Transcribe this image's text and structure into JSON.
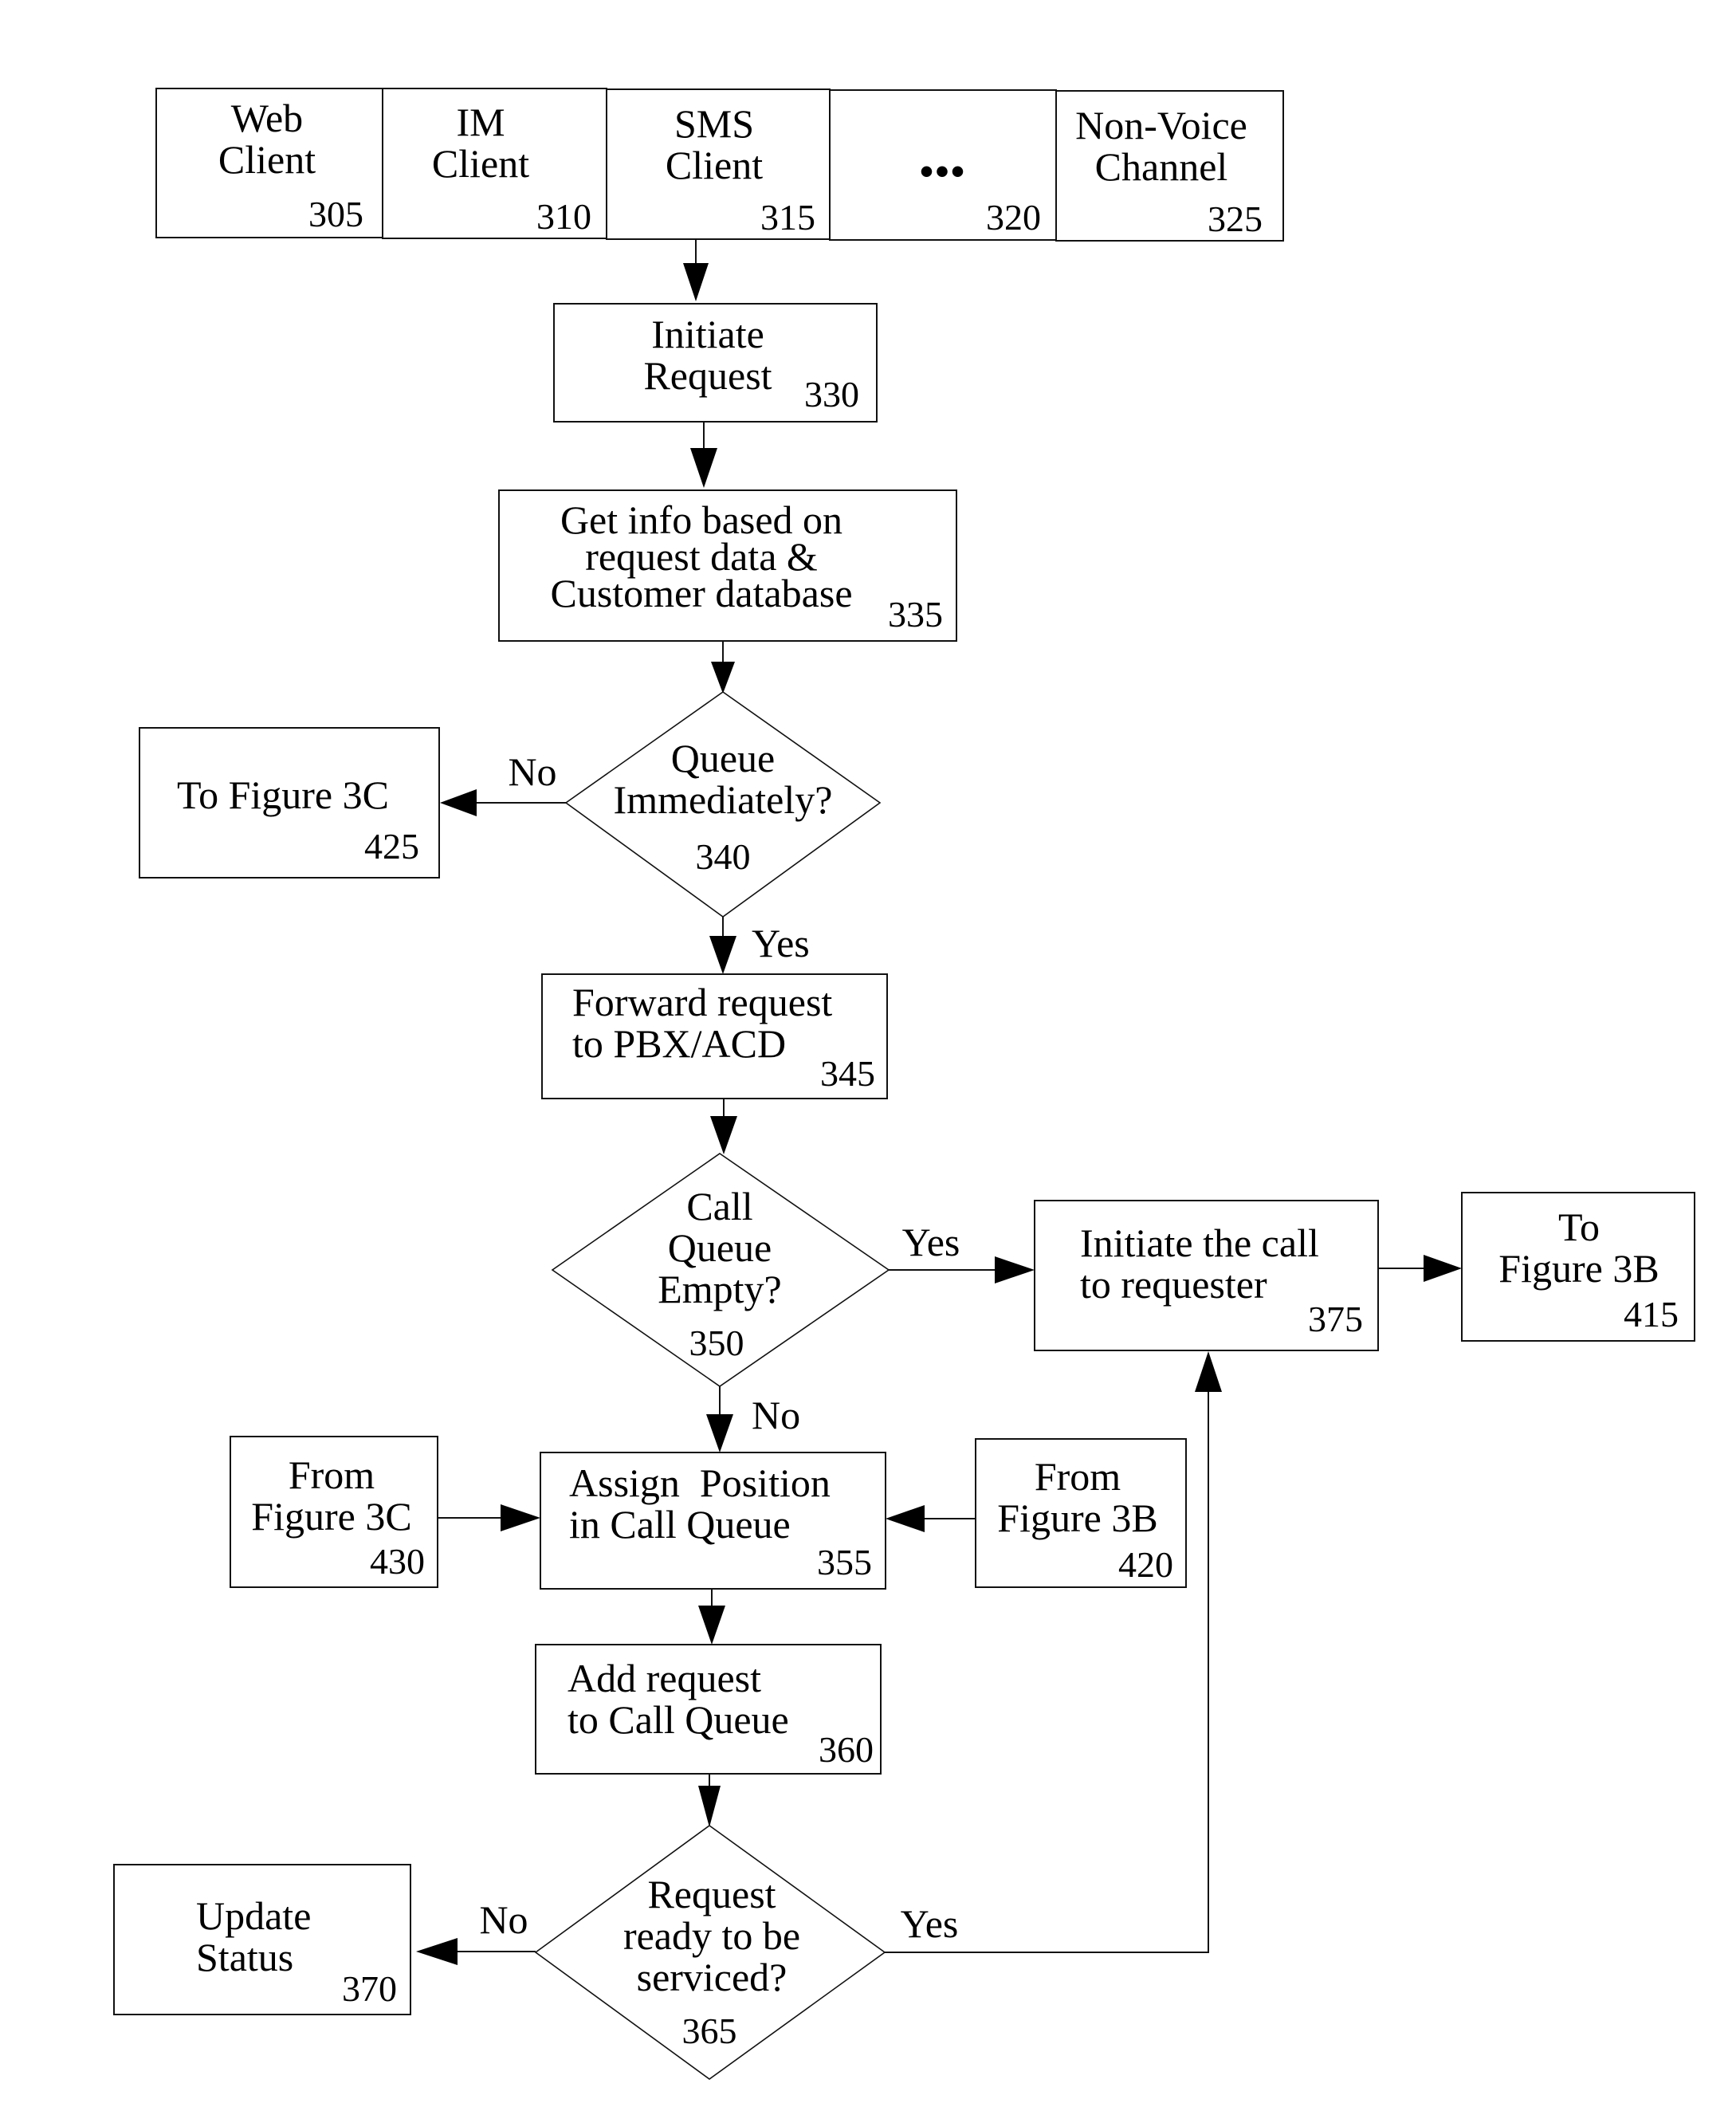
{
  "diagram": {
    "type": "flowchart",
    "channels": [
      {
        "id": "305",
        "lines": [
          "Web",
          "Client"
        ]
      },
      {
        "id": "310",
        "lines": [
          "IM",
          "Client"
        ]
      },
      {
        "id": "315",
        "lines": [
          "SMS",
          "Client"
        ]
      },
      {
        "id": "320",
        "lines": [
          "•••"
        ]
      },
      {
        "id": "325",
        "lines": [
          "Non-Voice",
          "Channel"
        ]
      }
    ],
    "nodes": {
      "n330": {
        "id": "330",
        "lines": [
          "Initiate",
          "Request"
        ]
      },
      "n335": {
        "id": "335",
        "lines": [
          "Get info based on",
          "request data &",
          "Customer database"
        ]
      },
      "n340": {
        "id": "340",
        "lines": [
          "Queue",
          "Immediately?"
        ],
        "shape": "decision"
      },
      "n425": {
        "id": "425",
        "lines": [
          "To Figure 3C"
        ]
      },
      "n345": {
        "id": "345",
        "lines": [
          "Forward request",
          "to PBX/ACD"
        ]
      },
      "n350": {
        "id": "350",
        "lines": [
          "Call",
          "Queue",
          "Empty?"
        ],
        "shape": "decision"
      },
      "n375": {
        "id": "375",
        "lines": [
          "Initiate the call",
          "to requester"
        ]
      },
      "n415": {
        "id": "415",
        "lines": [
          "To",
          "Figure 3B"
        ]
      },
      "n430": {
        "id": "430",
        "lines": [
          "From",
          "Figure 3C"
        ]
      },
      "n355": {
        "id": "355",
        "lines": [
          "Assign  Position",
          "in Call Queue"
        ]
      },
      "n420": {
        "id": "420",
        "lines": [
          "From",
          "Figure 3B"
        ]
      },
      "n360": {
        "id": "360",
        "lines": [
          "Add request",
          "to Call Queue"
        ]
      },
      "n365": {
        "id": "365",
        "lines": [
          "Request",
          "ready to be",
          "serviced?"
        ],
        "shape": "decision"
      },
      "n370": {
        "id": "370",
        "lines": [
          "Update",
          "Status"
        ]
      }
    },
    "edge_labels": {
      "e340_no": "No",
      "e340_yes": "Yes",
      "e350_yes": "Yes",
      "e350_no": "No",
      "e365_no": "No",
      "e365_yes": "Yes"
    },
    "edges": [
      {
        "from": "channels",
        "to": "330"
      },
      {
        "from": "330",
        "to": "335"
      },
      {
        "from": "335",
        "to": "340"
      },
      {
        "from": "340",
        "to": "425",
        "label": "No"
      },
      {
        "from": "340",
        "to": "345",
        "label": "Yes"
      },
      {
        "from": "345",
        "to": "350"
      },
      {
        "from": "350",
        "to": "375",
        "label": "Yes"
      },
      {
        "from": "350",
        "to": "355",
        "label": "No"
      },
      {
        "from": "375",
        "to": "415"
      },
      {
        "from": "430",
        "to": "355"
      },
      {
        "from": "420",
        "to": "355"
      },
      {
        "from": "355",
        "to": "360"
      },
      {
        "from": "360",
        "to": "365"
      },
      {
        "from": "365",
        "to": "370",
        "label": "No"
      },
      {
        "from": "365",
        "to": "375",
        "label": "Yes"
      }
    ]
  }
}
